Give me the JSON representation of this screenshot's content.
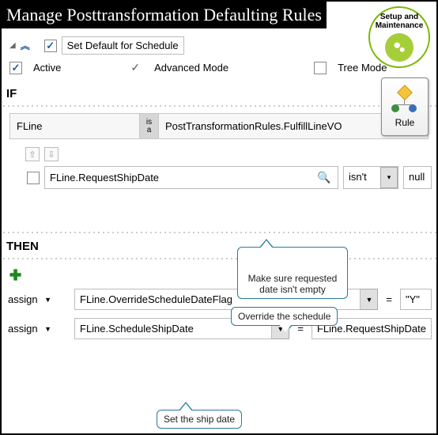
{
  "titlebar": "Manage Posttransformation Defaulting Rules",
  "setup": {
    "line1": "Setup and",
    "line2": "Maintenance"
  },
  "ruleButton": {
    "label": "Rule"
  },
  "toolbar": {
    "ruleNameField": "Set Default for Schedule"
  },
  "options": {
    "active": "Active",
    "advanced": "Advanced Mode",
    "tree": "Tree Mode"
  },
  "sections": {
    "if": "IF",
    "then": "THEN"
  },
  "isBar": {
    "left": "FLine",
    "midTop": "is",
    "midBot": "a",
    "right": "PostTransformationRules.FulfillLineVO"
  },
  "condition": {
    "field": "FLine.RequestShipDate",
    "op": "isn't",
    "val": "null"
  },
  "callouts": {
    "makeSure": "Make sure requested\ndate isn't empty",
    "override": "Override  the schedule",
    "setShip": "Set the ship date"
  },
  "assign": {
    "label": "assign",
    "row1": {
      "target": "FLine.OverrideScheduleDateFlag",
      "value": "\"Y\""
    },
    "row2": {
      "target": "FLine.ScheduleShipDate",
      "value": "FLine.RequestShipDate"
    }
  },
  "eq": "="
}
